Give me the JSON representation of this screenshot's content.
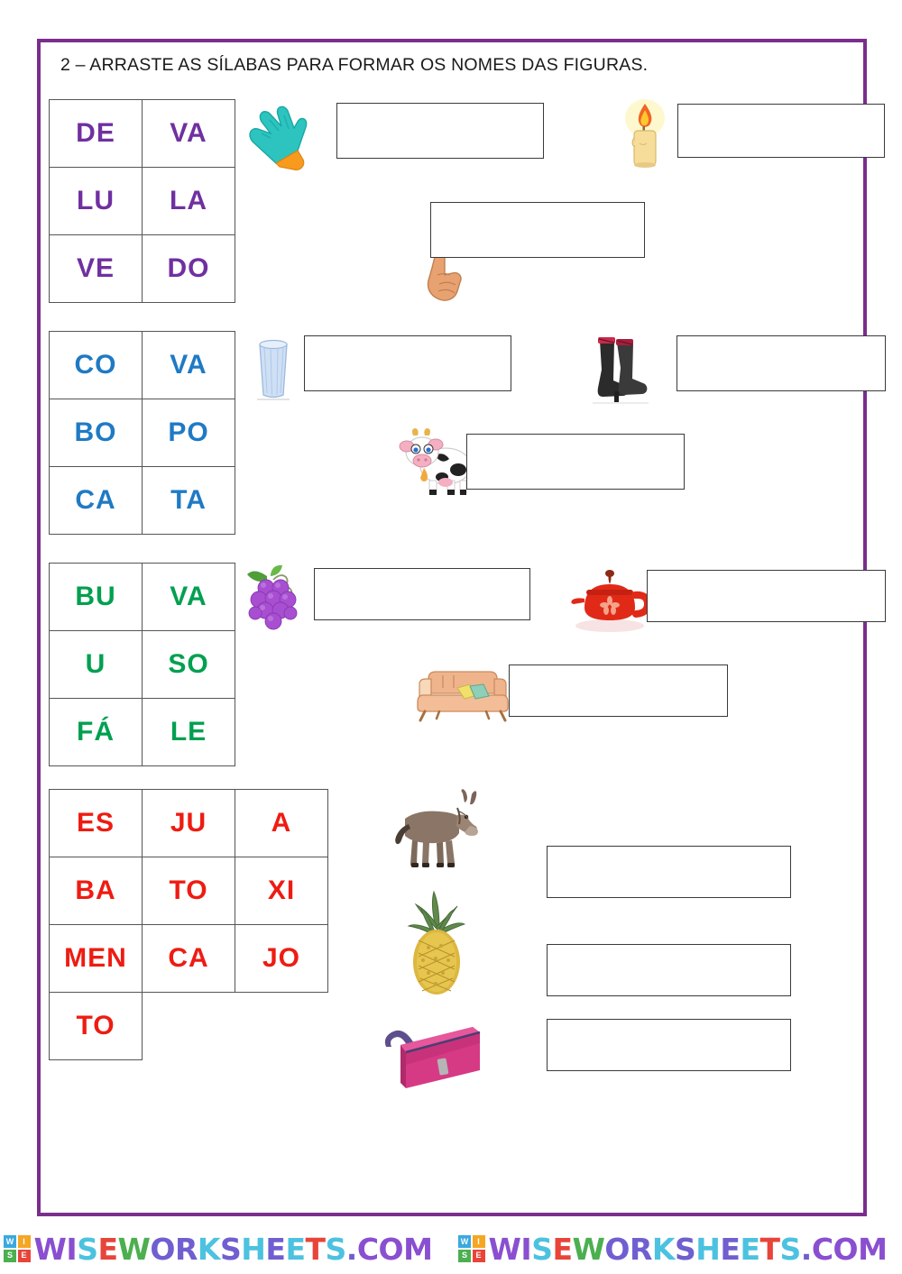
{
  "page": {
    "title": "2 – ARRASTE AS SÍLABAS PARA FORMAR OS NOMES DAS FIGURAS.",
    "border_color": "#7b2d8e",
    "background": "#ffffff"
  },
  "sections": [
    {
      "id": "section-1",
      "color": "#7030a0",
      "syllable_table": {
        "columns": 2,
        "rows": [
          [
            "DE",
            "VA"
          ],
          [
            "LU",
            "LA"
          ],
          [
            "VE",
            "DO"
          ]
        ]
      },
      "items": [
        {
          "icon": "glove-icon",
          "label": "luva-picture",
          "answer_value": "",
          "answer_placeholder": ""
        },
        {
          "icon": "candle-icon",
          "label": "vela-picture",
          "answer_value": "",
          "answer_placeholder": ""
        },
        {
          "icon": "pointing-finger-icon",
          "label": "dedo-picture",
          "answer_value": "",
          "answer_placeholder": ""
        }
      ]
    },
    {
      "id": "section-2",
      "color": "#1f7ac4",
      "syllable_table": {
        "columns": 2,
        "rows": [
          [
            "CO",
            "VA"
          ],
          [
            "BO",
            "PO"
          ],
          [
            "CA",
            "TA"
          ]
        ]
      },
      "items": [
        {
          "icon": "cup-icon",
          "label": "copo-picture",
          "answer_value": "",
          "answer_placeholder": ""
        },
        {
          "icon": "boots-icon",
          "label": "botas-picture",
          "answer_value": "",
          "answer_placeholder": ""
        },
        {
          "icon": "cow-icon",
          "label": "vaca-picture",
          "answer_value": "",
          "answer_placeholder": ""
        }
      ]
    },
    {
      "id": "section-3",
      "color": "#00a050",
      "syllable_table": {
        "columns": 2,
        "rows": [
          [
            "BU",
            "VA"
          ],
          [
            "U",
            "SO"
          ],
          [
            "FÁ",
            "LE"
          ]
        ]
      },
      "items": [
        {
          "icon": "grapes-icon",
          "label": "uva-picture",
          "answer_value": "",
          "answer_placeholder": ""
        },
        {
          "icon": "teapot-icon",
          "label": "bule-picture",
          "answer_value": "",
          "answer_placeholder": ""
        },
        {
          "icon": "sofa-icon",
          "label": "sofa-picture",
          "answer_value": "",
          "answer_placeholder": ""
        }
      ]
    },
    {
      "id": "section-4",
      "color": "#ee1c12",
      "syllable_table": {
        "columns": 3,
        "rows": [
          [
            "ES",
            "JU",
            "A"
          ],
          [
            "BA",
            "TO",
            "XI"
          ],
          [
            "MEN",
            "CA",
            "JO"
          ],
          [
            "TO",
            "",
            ""
          ]
        ]
      },
      "items": [
        {
          "icon": "donkey-icon",
          "label": "jumento-picture",
          "answer_value": "",
          "answer_placeholder": ""
        },
        {
          "icon": "pineapple-icon",
          "label": "abacaxi-picture",
          "answer_value": "",
          "answer_placeholder": ""
        },
        {
          "icon": "pencil-case-icon",
          "label": "estojo-picture",
          "answer_value": "",
          "answer_placeholder": ""
        }
      ]
    }
  ],
  "footer": {
    "watermark_text": "WISEWORKSHEETS.COM",
    "logo_letters": [
      "W",
      "I",
      "S",
      "E"
    ],
    "logo_colors": [
      "#3aa9e0",
      "#f5a623",
      "#4caf50",
      "#e8443a"
    ],
    "letter_colors": [
      "#8a4fd0",
      "#8a4fd0",
      "#4cc2e0",
      "#e8443a",
      "#4caf50",
      "#6f5fd0",
      "#6f5fd0",
      "#4cc2e0",
      "#6f5fd0",
      "#4cc2e0",
      "#6f5fd0",
      "#4cc2e0",
      "#e8443a",
      "#4cc2e0",
      "#6f5fd0",
      "#8a4fd0",
      "#8a4fd0",
      "#8a4fd0"
    ],
    "repeat": 2
  }
}
